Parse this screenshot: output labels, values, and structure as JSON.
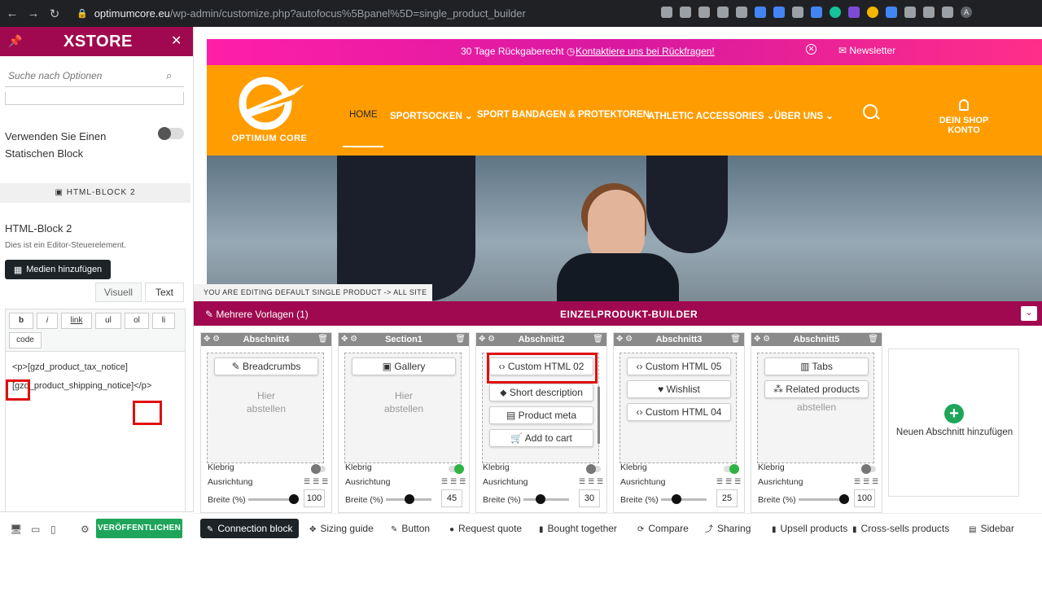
{
  "browser": {
    "url_host": "optimumcore.eu",
    "url_path": "/wp-admin/customize.php?autofocus%5Bpanel%5D=single_product_builder",
    "profile_initial": "A"
  },
  "panel": {
    "brand": "XSTORE",
    "search_placeholder": "Suche nach Optionen",
    "static_block_label": "Verwenden Sie Einen Statischen Block",
    "section_header": "HTML-BLOCK 2",
    "html_block_title": "HTML-Block 2",
    "html_block_desc": "Dies ist ein Editor-Steuerelement.",
    "media_button": "Medien hinzufügen",
    "tab_visual": "Visuell",
    "tab_text": "Text",
    "quicktags": [
      "b",
      "i",
      "link",
      "ul",
      "ol",
      "li",
      "code"
    ],
    "editor_line1": "<p>[gzd_product_tax_notice]",
    "editor_line2": "[gzd_product_shipping_notice]</p>",
    "publish_button": "VERÖFFENTLICHEN"
  },
  "preview": {
    "topbar_return": "30 Tage Rückgaberecht",
    "topbar_contact": "Kontaktiere uns bei Rückfragen!",
    "topbar_newsletter": "Newsletter",
    "logo_text": "OPTIMUM CORE",
    "menu": [
      "HOME",
      "SPORTSOCKEN",
      "SPORT BANDAGEN & PROTEKTOREN",
      "ATHLETIC ACCESSORIES",
      "ÜBER UNS"
    ],
    "account": "DEIN SHOP KONTO",
    "editing_notice": "YOU ARE EDITING DEFAULT SINGLE PRODUCT -> ALL SITE"
  },
  "builder": {
    "templates_label": "Mehrere Vorlagen (1)",
    "title": "EINZELPRODUKT-BUILDER",
    "sticky_label": "Klebrig",
    "align_label": "Ausrichtung",
    "width_label": "Breite (%)",
    "drop_hint_1": "Hier",
    "drop_hint_2": "abstellen",
    "sections": [
      {
        "name": "Abschnitt4",
        "blocks": [
          "Breadcrumbs"
        ],
        "placeholder": true,
        "sticky": false,
        "width": "100",
        "width_value": 100
      },
      {
        "name": "Section1",
        "blocks": [
          "Gallery"
        ],
        "placeholder": true,
        "sticky": true,
        "width": "45",
        "width_value": 45
      },
      {
        "name": "Abschnitt2",
        "blocks": [
          "Custom HTML 02",
          "Short description",
          "Product meta",
          "Add to cart"
        ],
        "placeholder": false,
        "sticky": false,
        "width": "30",
        "width_value": 30
      },
      {
        "name": "Abschnitt3",
        "blocks": [
          "Custom HTML 05",
          "Wishlist",
          "Custom HTML 04"
        ],
        "placeholder": false,
        "sticky": true,
        "width": "25",
        "width_value": 25
      },
      {
        "name": "Abschnitt5",
        "blocks": [
          "Tabs",
          "Related products"
        ],
        "placeholder": false,
        "partial_hint": "abstellen",
        "sticky": false,
        "width": "100",
        "width_value": 100
      }
    ],
    "new_section": "Neuen Abschnitt hinzufügen"
  },
  "toolbar": [
    "Connection block",
    "Sizing guide",
    "Button",
    "Request quote",
    "Bought together",
    "Compare",
    "Sharing",
    "Upsell products",
    "Cross-sells products",
    "Sidebar"
  ],
  "colors": {
    "brand": "#a0094f",
    "header": "#ff9d00",
    "publish": "#1ea55a",
    "highlight": "#e01010"
  }
}
